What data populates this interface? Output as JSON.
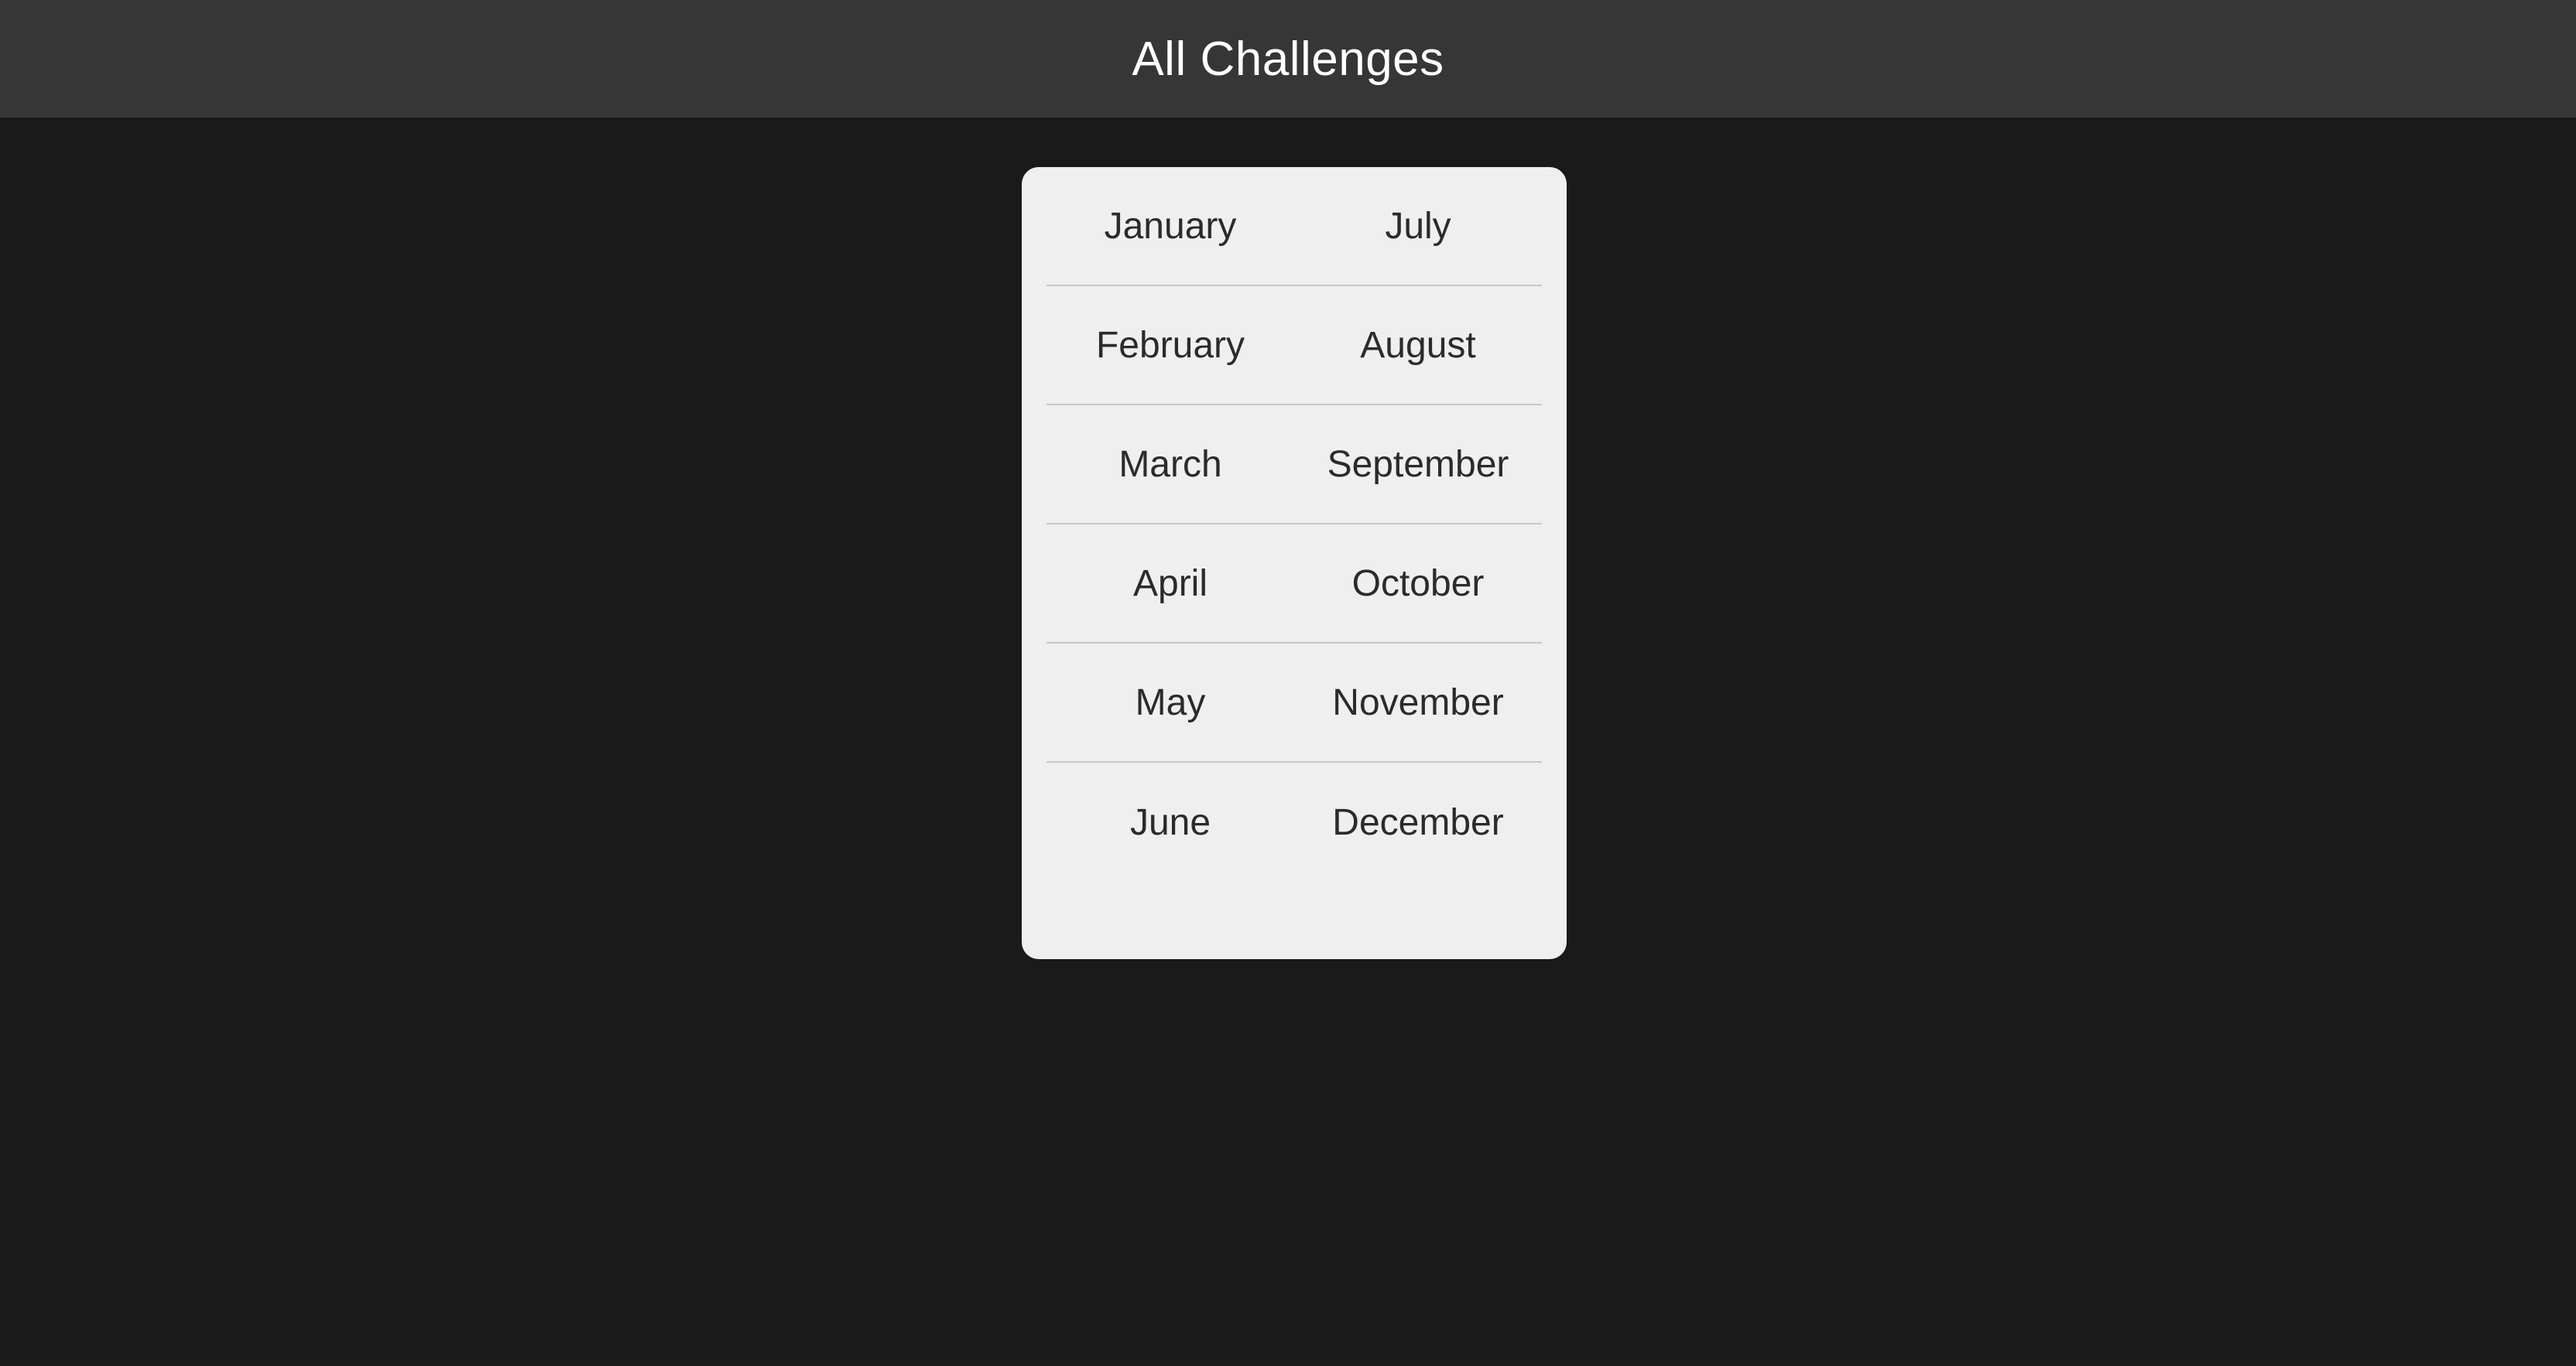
{
  "header": {
    "title": "All Challenges"
  },
  "months": {
    "rows": [
      [
        "January",
        "July"
      ],
      [
        "February",
        "August"
      ],
      [
        "March",
        "September"
      ],
      [
        "April",
        "October"
      ],
      [
        "May",
        "November"
      ],
      [
        "June",
        "December"
      ]
    ]
  },
  "colors": {
    "page_background": "#1a1a1a",
    "header_background": "#363636",
    "card_background": "#efefef",
    "text_dark": "#2b2b2b",
    "divider": "#c8c8c8"
  }
}
